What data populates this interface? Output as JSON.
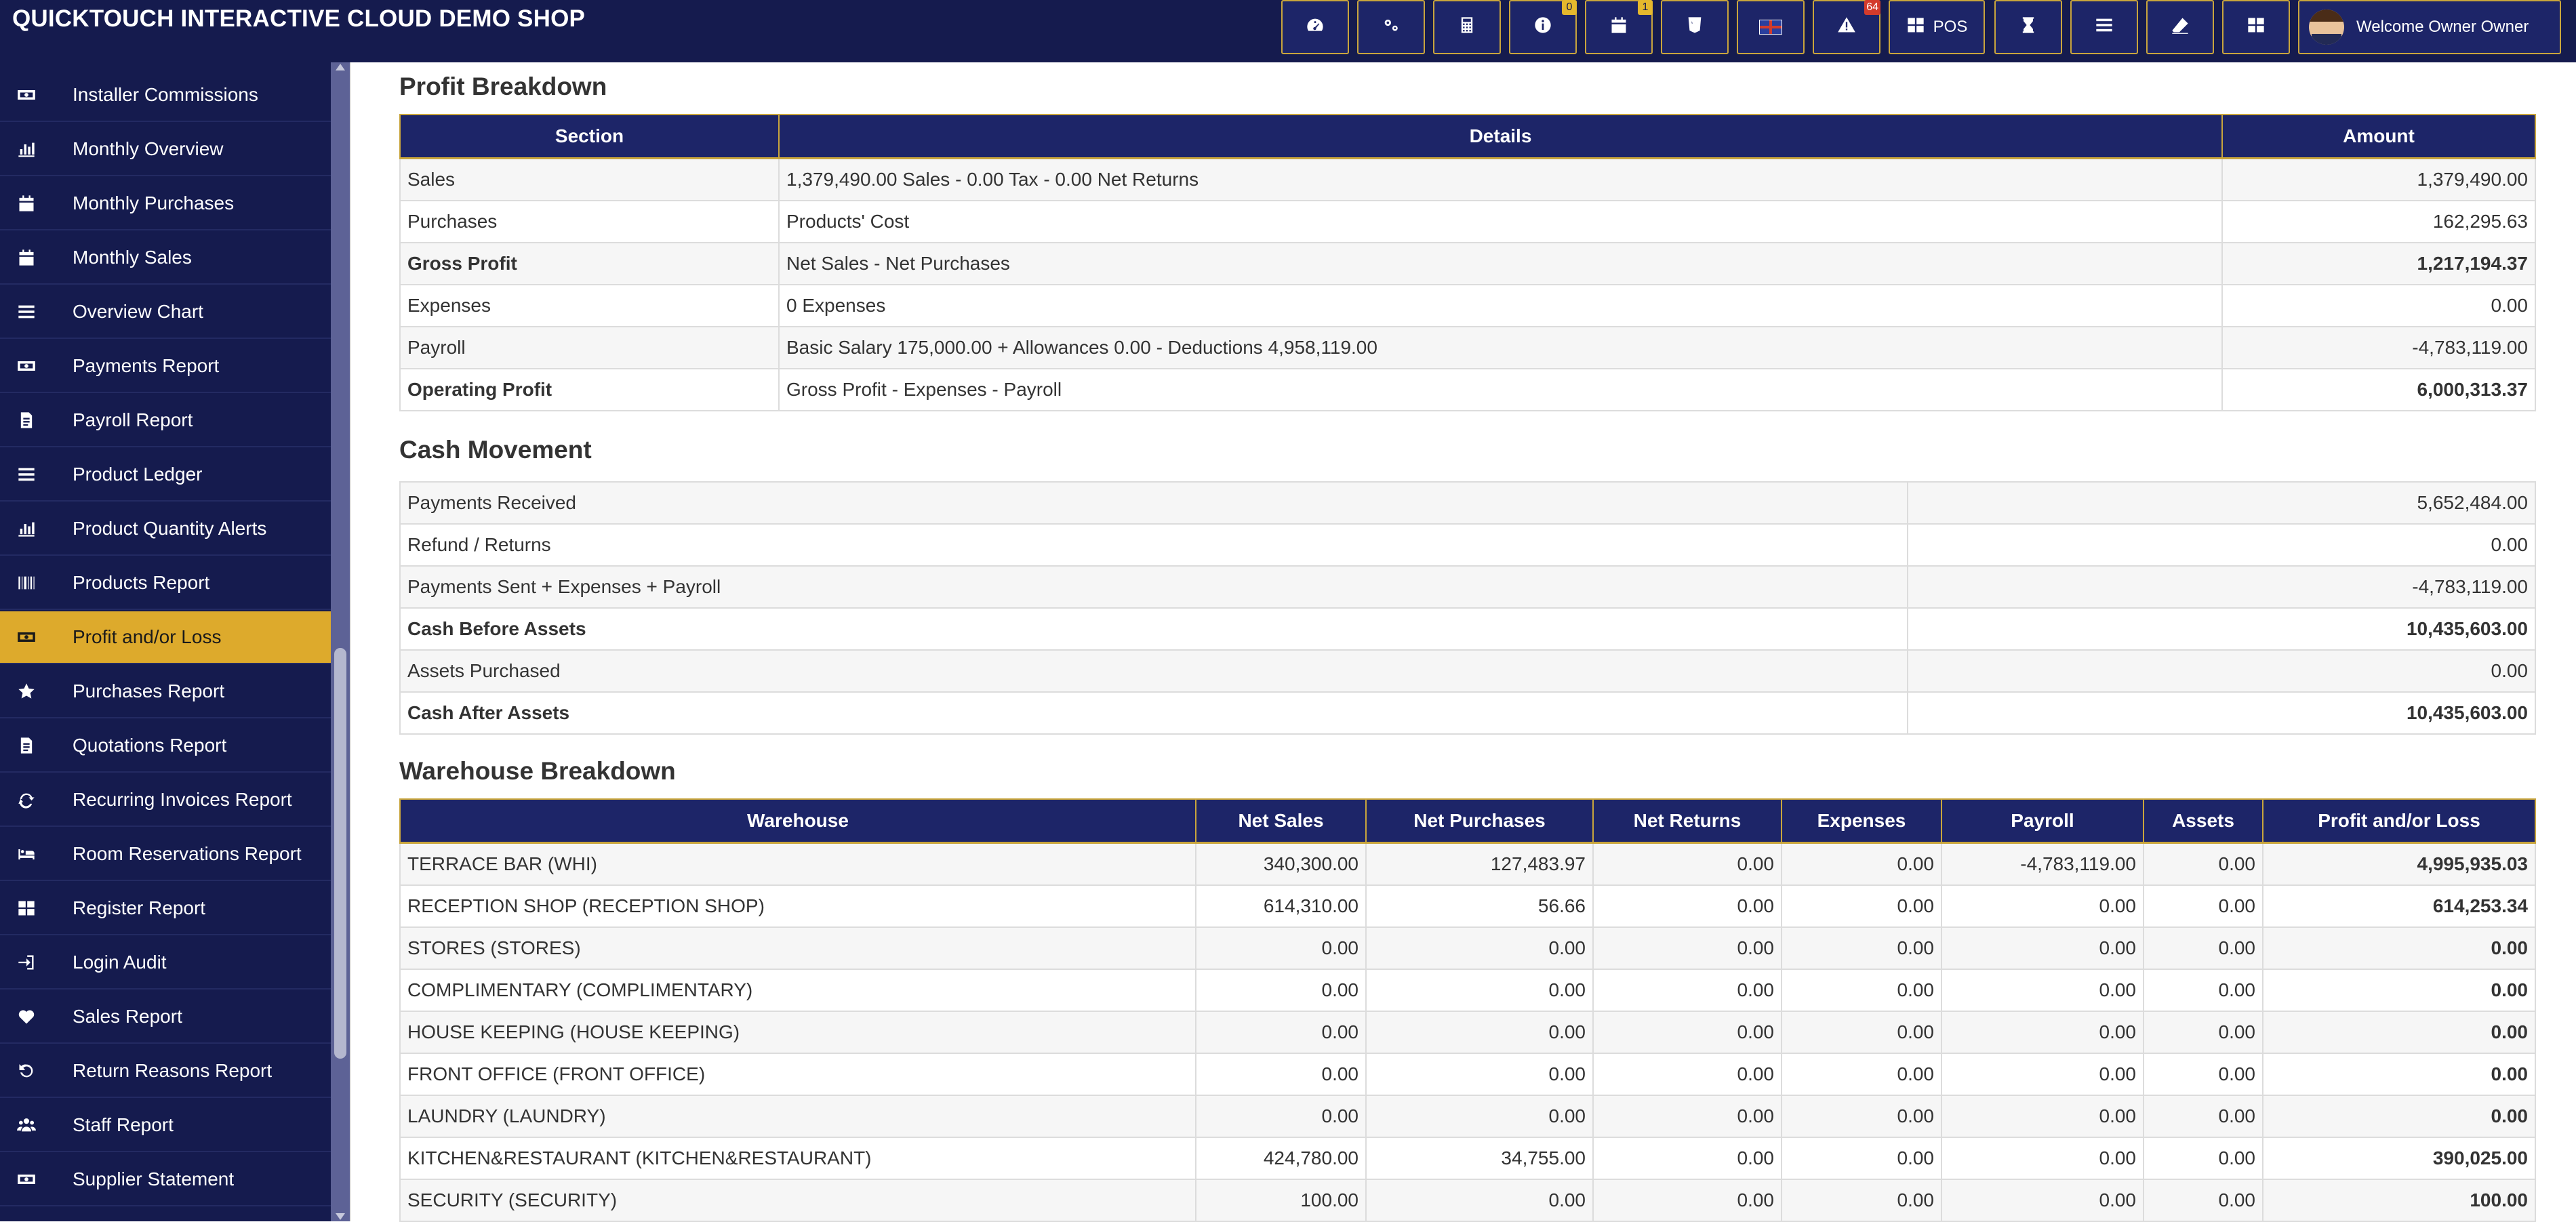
{
  "app": {
    "title": "QUICKTOUCH INTERACTIVE CLOUD DEMO SHOP"
  },
  "topbar": {
    "buttons": [
      {
        "name": "dashboard-icon",
        "badge": ""
      },
      {
        "name": "settings-icon",
        "badge": ""
      },
      {
        "name": "calculator-icon",
        "badge": ""
      },
      {
        "name": "info-icon",
        "badge": "0"
      },
      {
        "name": "calendar-icon",
        "badge": "1"
      },
      {
        "name": "html5-icon",
        "badge": ""
      },
      {
        "name": "uk-flag-icon",
        "badge": ""
      },
      {
        "name": "warning-icon",
        "badge": "64"
      }
    ],
    "pos_label": "POS",
    "welcome": "Welcome Owner Owner"
  },
  "sidebar": {
    "items": [
      {
        "label": "Installer Commissions",
        "icon": "money-icon"
      },
      {
        "label": "Monthly Overview",
        "icon": "bar-chart-icon"
      },
      {
        "label": "Monthly Purchases",
        "icon": "calendar-icon"
      },
      {
        "label": "Monthly Sales",
        "icon": "calendar-icon"
      },
      {
        "label": "Overview Chart",
        "icon": "list-icon"
      },
      {
        "label": "Payments Report",
        "icon": "money-icon"
      },
      {
        "label": "Payroll Report",
        "icon": "file-icon"
      },
      {
        "label": "Product Ledger",
        "icon": "list-icon"
      },
      {
        "label": "Product Quantity Alerts",
        "icon": "bar-chart-icon"
      },
      {
        "label": "Products Report",
        "icon": "barcode-icon"
      },
      {
        "label": "Profit and/or Loss",
        "icon": "money-icon"
      },
      {
        "label": "Purchases Report",
        "icon": "star-icon"
      },
      {
        "label": "Quotations Report",
        "icon": "file-icon"
      },
      {
        "label": "Recurring Invoices Report",
        "icon": "refresh-icon"
      },
      {
        "label": "Room Reservations Report",
        "icon": "bed-icon"
      },
      {
        "label": "Register Report",
        "icon": "grid-icon"
      },
      {
        "label": "Login Audit",
        "icon": "sign-in-icon"
      },
      {
        "label": "Sales Report",
        "icon": "heart-icon"
      },
      {
        "label": "Return Reasons Report",
        "icon": "undo-icon"
      },
      {
        "label": "Staff Report",
        "icon": "users-icon"
      },
      {
        "label": "Supplier Statement",
        "icon": "money-icon"
      }
    ],
    "active_index": 10
  },
  "profit_breakdown": {
    "title": "Profit Breakdown",
    "headers": [
      "Section",
      "Details",
      "Amount"
    ],
    "rows": [
      {
        "section": "Sales",
        "details": "1,379,490.00 Sales - 0.00 Tax - 0.00 Net Returns",
        "amount": "1,379,490.00",
        "bold": false
      },
      {
        "section": "Purchases",
        "details": "Products' Cost",
        "amount": "162,295.63",
        "bold": false
      },
      {
        "section": "Gross Profit",
        "details": "Net Sales - Net Purchases",
        "amount": "1,217,194.37",
        "bold": true
      },
      {
        "section": "Expenses",
        "details": "0 Expenses",
        "amount": "0.00",
        "bold": false
      },
      {
        "section": "Payroll",
        "details": "Basic Salary 175,000.00 + Allowances 0.00 - Deductions 4,958,119.00",
        "amount": "-4,783,119.00",
        "bold": false
      },
      {
        "section": "Operating Profit",
        "details": "Gross Profit - Expenses - Payroll",
        "amount": "6,000,313.37",
        "bold": true
      }
    ]
  },
  "cash_movement": {
    "title": "Cash Movement",
    "rows": [
      {
        "label": "Payments Received",
        "amount": "5,652,484.00",
        "bold": false
      },
      {
        "label": "Refund / Returns",
        "amount": "0.00",
        "bold": false
      },
      {
        "label": "Payments Sent + Expenses + Payroll",
        "amount": "-4,783,119.00",
        "bold": false
      },
      {
        "label": "Cash Before Assets",
        "amount": "10,435,603.00",
        "bold": true
      },
      {
        "label": "Assets Purchased",
        "amount": "0.00",
        "bold": false
      },
      {
        "label": "Cash After Assets",
        "amount": "10,435,603.00",
        "bold": true
      }
    ]
  },
  "warehouse_breakdown": {
    "title": "Warehouse Breakdown",
    "headers": [
      "Warehouse",
      "Net Sales",
      "Net Purchases",
      "Net Returns",
      "Expenses",
      "Payroll",
      "Assets",
      "Profit and/or Loss"
    ],
    "rows": [
      [
        "TERRACE BAR (WHI)",
        "340,300.00",
        "127,483.97",
        "0.00",
        "0.00",
        "-4,783,119.00",
        "0.00",
        "4,995,935.03"
      ],
      [
        "RECEPTION SHOP (RECEPTION SHOP)",
        "614,310.00",
        "56.66",
        "0.00",
        "0.00",
        "0.00",
        "0.00",
        "614,253.34"
      ],
      [
        "STORES (STORES)",
        "0.00",
        "0.00",
        "0.00",
        "0.00",
        "0.00",
        "0.00",
        "0.00"
      ],
      [
        "COMPLIMENTARY (COMPLIMENTARY)",
        "0.00",
        "0.00",
        "0.00",
        "0.00",
        "0.00",
        "0.00",
        "0.00"
      ],
      [
        "HOUSE KEEPING (HOUSE KEEPING)",
        "0.00",
        "0.00",
        "0.00",
        "0.00",
        "0.00",
        "0.00",
        "0.00"
      ],
      [
        "FRONT OFFICE (FRONT OFFICE)",
        "0.00",
        "0.00",
        "0.00",
        "0.00",
        "0.00",
        "0.00",
        "0.00"
      ],
      [
        "LAUNDRY (LAUNDRY)",
        "0.00",
        "0.00",
        "0.00",
        "0.00",
        "0.00",
        "0.00",
        "0.00"
      ],
      [
        "KITCHEN&RESTAURANT (KITCHEN&RESTAURANT)",
        "424,780.00",
        "34,755.00",
        "0.00",
        "0.00",
        "0.00",
        "0.00",
        "390,025.00"
      ],
      [
        "SECURITY (SECURITY)",
        "100.00",
        "0.00",
        "0.00",
        "0.00",
        "0.00",
        "0.00",
        "100.00"
      ]
    ]
  }
}
